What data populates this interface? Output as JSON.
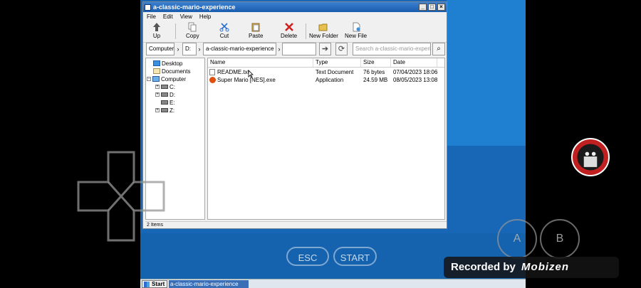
{
  "window": {
    "title": "a-classic-mario-experience",
    "minimize": "_",
    "maximize": "□",
    "close": "×"
  },
  "menu": [
    "File",
    "Edit",
    "View",
    "Help"
  ],
  "toolbar": {
    "up": "Up",
    "copy": "Copy",
    "cut": "Cut",
    "paste": "Paste",
    "delete": "Delete",
    "new_folder": "New Folder",
    "new_file": "New File"
  },
  "address": {
    "crumbs": [
      "Computer",
      "D:",
      "a-classic-mario-experience"
    ],
    "search_placeholder": "Search a-classic-mario-experience"
  },
  "tree": {
    "desktop": "Desktop",
    "documents": "Documents",
    "computer": "Computer",
    "drives": [
      "C:",
      "D:",
      "E:",
      "Z:"
    ]
  },
  "columns": [
    "Name",
    "Type",
    "Size",
    "Date"
  ],
  "files": [
    {
      "name": "README.txt",
      "type": "Text Document",
      "size": "76 bytes",
      "date": "07/04/2023 18:06"
    },
    {
      "name": "Super Mario [NES].exe",
      "type": "Application",
      "size": "24.59 MB",
      "date": "08/05/2023 13:08"
    }
  ],
  "status": "2 Items",
  "taskbar": {
    "start": "Start",
    "task": "a-classic-mario-experience"
  },
  "overlay": {
    "esc": "ESC",
    "start": "START",
    "a": "A",
    "b": "B"
  },
  "recorder": {
    "prefix": "Recorded by",
    "brand": "Mobizen"
  },
  "colors": {
    "desktop": "#1767b6",
    "titlebar": "#1a5cae",
    "recorder_bg": "#141414"
  }
}
